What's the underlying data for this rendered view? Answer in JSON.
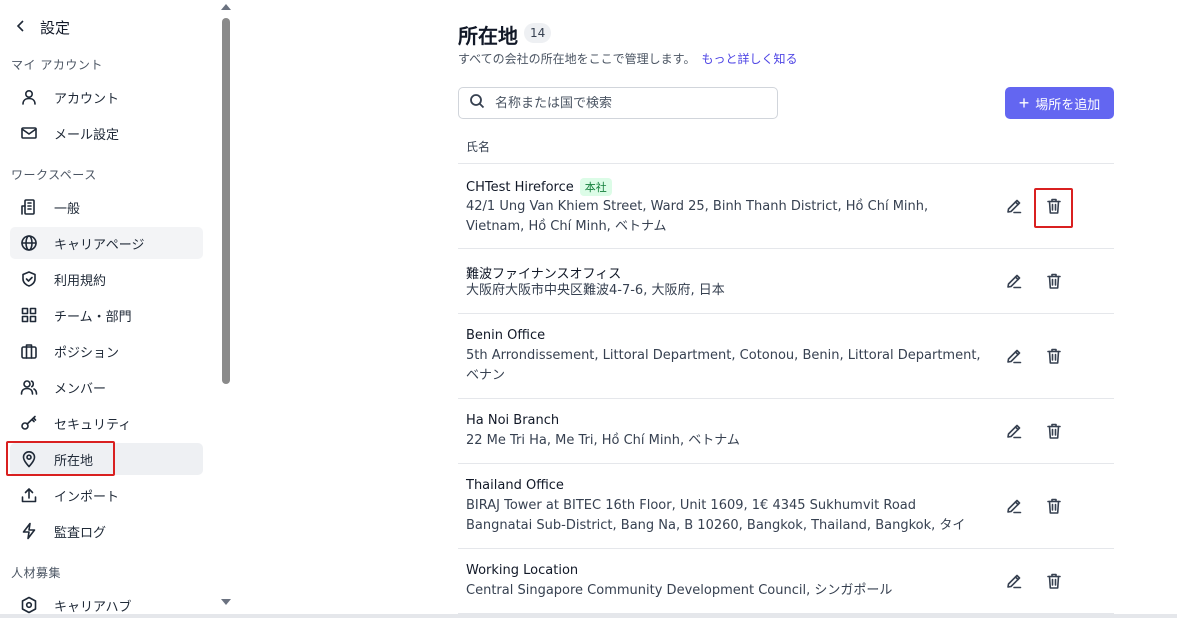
{
  "sidebar": {
    "back_title": "設定",
    "sections": [
      {
        "label": "マイ アカウント"
      },
      {
        "label": "ワークスペース"
      },
      {
        "label": "人材募集"
      }
    ],
    "items": [
      {
        "label": "アカウント",
        "icon": "user-icon"
      },
      {
        "label": "メール設定",
        "icon": "mail-icon"
      },
      {
        "label": "一般",
        "icon": "building-icon"
      },
      {
        "label": "キャリアページ",
        "icon": "globe-icon"
      },
      {
        "label": "利用規約",
        "icon": "shield-icon"
      },
      {
        "label": "チーム・部門",
        "icon": "grid-icon"
      },
      {
        "label": "ポジション",
        "icon": "briefcase-icon"
      },
      {
        "label": "メンバー",
        "icon": "users-icon"
      },
      {
        "label": "セキュリティ",
        "icon": "key-icon"
      },
      {
        "label": "所在地",
        "icon": "map-pin-icon"
      },
      {
        "label": "インポート",
        "icon": "upload-icon"
      },
      {
        "label": "監査ログ",
        "icon": "lightning-icon"
      },
      {
        "label": "キャリアハブ",
        "icon": "career-hub-icon"
      }
    ]
  },
  "main": {
    "title": "所在地",
    "count": "14",
    "subtitle": "すべての会社の所在地をここで管理します。",
    "learn_more": "もっと詳しく知る",
    "search_placeholder": "名称または国で検索",
    "add_button": "場所を追加",
    "column_header": "氏名",
    "locations": [
      {
        "name": "CHTest Hireforce",
        "badge": "本社",
        "address": "42/1 Ung Van Khiem Street, Ward 25, Binh Thanh District, Hồ Chí Minh, Vietnam, Hồ Chí Minh, ベトナム"
      },
      {
        "name": "難波ファイナンスオフィス",
        "badge": "",
        "address": "大阪府大阪市中央区難波4-7-6, 大阪府, 日本"
      },
      {
        "name": "Benin Office",
        "badge": "",
        "address": "5th Arrondissement, Littoral Department, Cotonou, Benin, Littoral Department, ベナン"
      },
      {
        "name": "Ha Noi Branch",
        "badge": "",
        "address": "22 Me Tri Ha, Me Tri, Hồ Chí Minh, ベトナム"
      },
      {
        "name": "Thailand Office",
        "badge": "",
        "address": "BIRAJ Tower at BITEC 16th Floor, Unit 1609, 1€ 4345 Sukhumvit Road Bangnatai Sub-District, Bang Na, B 10260, Bangkok, Thailand, Bangkok, タイ"
      },
      {
        "name": "Working Location",
        "badge": "",
        "address": "Central Singapore Community Development Council, シンガポール"
      }
    ]
  },
  "colors": {
    "accent": "#6366f1",
    "highlight_box": "#d92020",
    "hq_badge_bg": "#dcfce7",
    "hq_badge_text": "#15803d"
  }
}
